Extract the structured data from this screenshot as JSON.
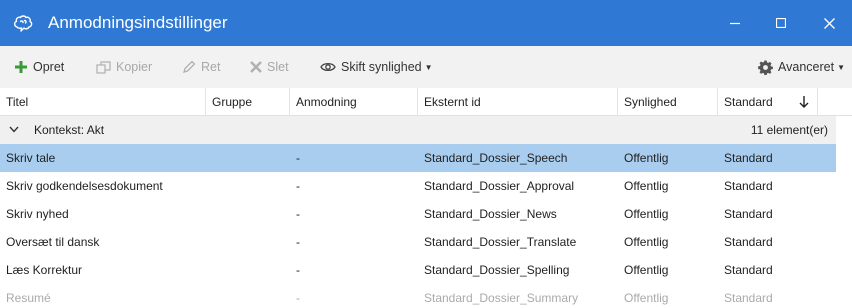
{
  "window": {
    "title": "Anmodningsindstillinger",
    "icon": "brain-icon",
    "accent": "#2f78d4"
  },
  "toolbar": {
    "create": "Opret",
    "copy": "Kopier",
    "edit": "Ret",
    "delete": "Slet",
    "visibility": "Skift synlighed",
    "advanced": "Avanceret"
  },
  "columns": {
    "title": "Titel",
    "group": "Gruppe",
    "request": "Anmodning",
    "external_id": "Eksternt id",
    "visibility": "Synlighed",
    "standard": "Standard"
  },
  "group": {
    "label": "Kontekst:  Akt",
    "count": "11 element(er)"
  },
  "rows": [
    {
      "title": "Skriv tale",
      "group": "",
      "request": "-",
      "external_id": "Standard_Dossier_Speech",
      "visibility": "Offentlig",
      "standard": "Standard",
      "selected": true
    },
    {
      "title": "Skriv godkendelsesdokument",
      "group": "",
      "request": "-",
      "external_id": "Standard_Dossier_Approval",
      "visibility": "Offentlig",
      "standard": "Standard"
    },
    {
      "title": "Skriv nyhed",
      "group": "",
      "request": "-",
      "external_id": "Standard_Dossier_News",
      "visibility": "Offentlig",
      "standard": "Standard"
    },
    {
      "title": "Oversæt til dansk",
      "group": "",
      "request": "-",
      "external_id": "Standard_Dossier_Translate",
      "visibility": "Offentlig",
      "standard": "Standard"
    },
    {
      "title": "Læs Korrektur",
      "group": "",
      "request": "-",
      "external_id": "Standard_Dossier_Spelling",
      "visibility": "Offentlig",
      "standard": "Standard"
    },
    {
      "title": "Resumé",
      "group": "",
      "request": "-",
      "external_id": "Standard_Dossier_Summary",
      "visibility": "Offentlig",
      "standard": "Standard",
      "dimmed": true
    }
  ]
}
